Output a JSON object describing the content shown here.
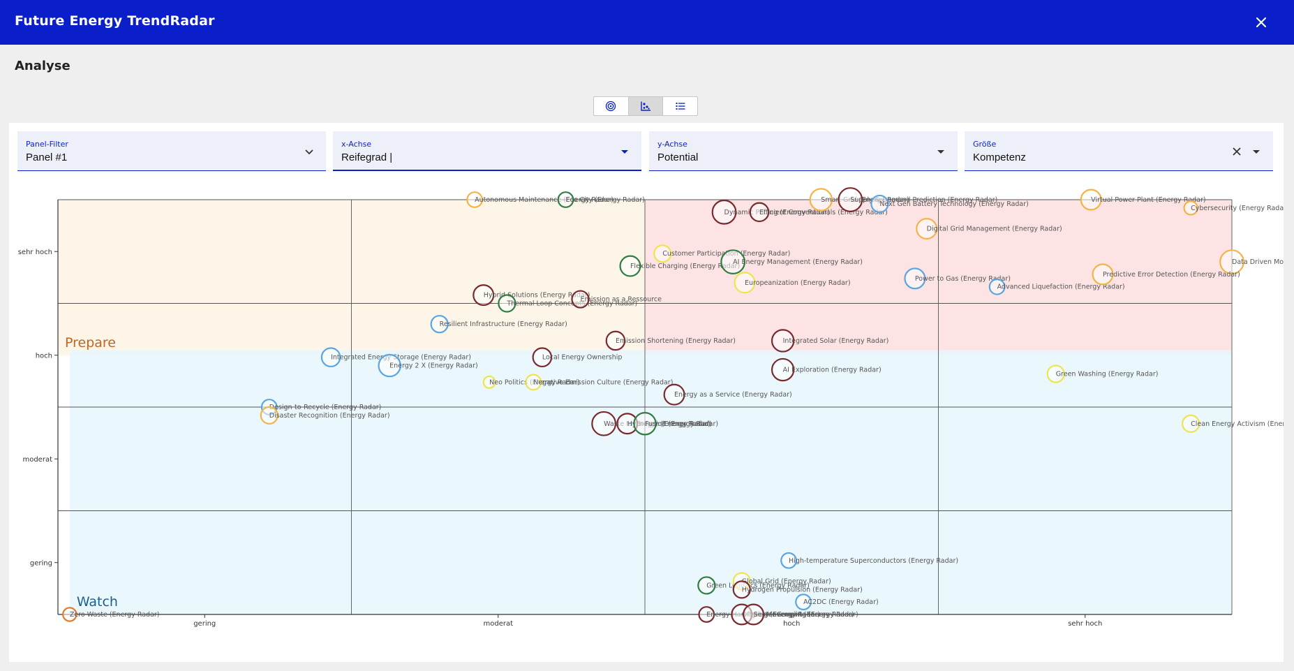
{
  "app": {
    "title": "Future Energy TrendRadar"
  },
  "page": {
    "heading": "Analyse"
  },
  "view_toggle": [
    {
      "name": "radar-view-button",
      "icon": "radar-icon",
      "active": false
    },
    {
      "name": "scatter-view-button",
      "icon": "scatter-chart-icon",
      "active": true
    },
    {
      "name": "list-view-button",
      "icon": "list-icon",
      "active": false
    }
  ],
  "filters": {
    "panel": {
      "label": "Panel-Filter",
      "value": "Panel #1"
    },
    "x_axis": {
      "label": "x-Achse",
      "value": "Reifegrad |"
    },
    "y_axis": {
      "label": "y-Achse",
      "value": "Potential"
    },
    "size": {
      "label": "Größe",
      "value": "Kompetenz"
    }
  },
  "colors": {
    "brand": "#0a1fc9",
    "prepare_zone": "#fdf5e8",
    "act_zone": "#fde3e4",
    "watch_zone": "#e6f6fc",
    "prepare_text": "#c0661f",
    "watch_text": "#1b5f92"
  },
  "chart_data": {
    "type": "scatter",
    "x_ticks": [
      "gering",
      "moderat",
      "hoch",
      "sehr hoch"
    ],
    "y_ticks": [
      "gering",
      "moderat",
      "hoch",
      "sehr hoch"
    ],
    "xlim": [
      0,
      4
    ],
    "ylim": [
      0,
      4
    ],
    "zones": [
      {
        "label": "Prepare",
        "color": "#fdf5e8",
        "text_color": "#c0661f",
        "x": [
          0,
          2
        ],
        "y": [
          2.5,
          4
        ]
      },
      {
        "label": "",
        "color": "#fde3e4",
        "text_color": "#c0661f",
        "x": [
          2,
          4
        ],
        "y": [
          2.5,
          4
        ]
      },
      {
        "label": "Watch",
        "color": "#e6f6fc",
        "text_color": "#1b5f92",
        "x": [
          0.04,
          4
        ],
        "y": [
          0,
          2.55
        ]
      }
    ],
    "points": [
      {
        "label": "Autonomous Maintenance (Energy Radar)",
        "x": 1.42,
        "y": 4.0,
        "size": 0.9,
        "color": "#f3b347"
      },
      {
        "label": "Eco City (Energy Radar)",
        "x": 1.73,
        "y": 4.0,
        "size": 0.9,
        "color": "#2f7d43"
      },
      {
        "label": "Dynamic Pricing (Energy Radar)",
        "x": 2.27,
        "y": 3.88,
        "size": 1.4,
        "color": "#7a2a2f"
      },
      {
        "label": "Efficient Conventionals (Energy Radar)",
        "x": 2.39,
        "y": 3.88,
        "size": 1.1,
        "color": "#7a2a2f"
      },
      {
        "label": "Smart Grid (Energy Radar)",
        "x": 2.6,
        "y": 4.0,
        "size": 1.3,
        "color": "#f3b347"
      },
      {
        "label": "Supply & Demand Prediction (Energy Radar)",
        "x": 2.7,
        "y": 4.0,
        "size": 1.4,
        "color": "#7a2a2f"
      },
      {
        "label": "Next Gen Battery Technology (Energy Radar)",
        "x": 2.8,
        "y": 3.96,
        "size": 1.0,
        "color": "#5aa5e2"
      },
      {
        "label": "Virtual Power Plant (Energy Radar)",
        "x": 3.52,
        "y": 4.0,
        "size": 1.2,
        "color": "#f3b347"
      },
      {
        "label": "Cybersecurity (Energy Radar)",
        "x": 3.86,
        "y": 3.92,
        "size": 0.8,
        "color": "#f3b347"
      },
      {
        "label": "Digital Grid Management (Energy Radar)",
        "x": 2.96,
        "y": 3.72,
        "size": 1.2,
        "color": "#f3b347"
      },
      {
        "label": "Data Driven Modelling (Energy Radar)",
        "x": 4.0,
        "y": 3.4,
        "size": 1.4,
        "color": "#f3b347"
      },
      {
        "label": "Customer Participation (Energy Radar)",
        "x": 2.06,
        "y": 3.48,
        "size": 1.0,
        "color": "#ece54f"
      },
      {
        "label": "Flexible Charging (Energy Radar)",
        "x": 1.95,
        "y": 3.36,
        "size": 1.2,
        "color": "#2f7d43"
      },
      {
        "label": "AI Energy Management (Energy Radar)",
        "x": 2.3,
        "y": 3.4,
        "size": 1.4,
        "color": "#2f7d43"
      },
      {
        "label": "Europeanization (Energy Radar)",
        "x": 2.34,
        "y": 3.2,
        "size": 1.2,
        "color": "#ece54f"
      },
      {
        "label": "Power to Gas (Energy Radar)",
        "x": 2.92,
        "y": 3.24,
        "size": 1.2,
        "color": "#5aa5e2"
      },
      {
        "label": "Advanced Liquefaction (Energy Radar)",
        "x": 3.2,
        "y": 3.16,
        "size": 0.9,
        "color": "#5aa5e2"
      },
      {
        "label": "Predictive Error Detection (Energy Radar)",
        "x": 3.56,
        "y": 3.28,
        "size": 1.2,
        "color": "#f3b347"
      },
      {
        "label": "Hybrid Solutions (Energy Radar)",
        "x": 1.45,
        "y": 3.08,
        "size": 1.2,
        "color": "#7a2a2f"
      },
      {
        "label": "Thermal Loop Concepts (Energy Radar)",
        "x": 1.53,
        "y": 3.0,
        "size": 1.0,
        "color": "#2f7d43"
      },
      {
        "label": "Emission as a Ressource",
        "x": 1.78,
        "y": 3.04,
        "size": 1.0,
        "color": "#7a2a2f"
      },
      {
        "label": "Resilient Infrastructure (Energy Radar)",
        "x": 1.3,
        "y": 2.8,
        "size": 1.0,
        "color": "#5aa5e2"
      },
      {
        "label": "Emission Shortening (Energy Radar)",
        "x": 1.9,
        "y": 2.64,
        "size": 1.1,
        "color": "#7a2a2f"
      },
      {
        "label": "Integrated Solar (Energy Radar)",
        "x": 2.47,
        "y": 2.64,
        "size": 1.3,
        "color": "#7a2a2f"
      },
      {
        "label": "Integrated Energy Storage (Energy Radar)",
        "x": 0.93,
        "y": 2.48,
        "size": 1.1,
        "color": "#5aa5e2"
      },
      {
        "label": "Energy 2 X (Energy Radar)",
        "x": 1.13,
        "y": 2.4,
        "size": 1.3,
        "color": "#5aa5e2"
      },
      {
        "label": "Local Energy Ownership",
        "x": 1.65,
        "y": 2.48,
        "size": 1.1,
        "color": "#7a2a2f"
      },
      {
        "label": "Green Washing (Energy Radar)",
        "x": 3.4,
        "y": 2.32,
        "size": 1.0,
        "color": "#ece54f"
      },
      {
        "label": "Neo Politics (Energy Radar)",
        "x": 1.47,
        "y": 2.24,
        "size": 0.7,
        "color": "#ece54f"
      },
      {
        "label": "Negative Emission Culture (Energy Radar)",
        "x": 1.62,
        "y": 2.24,
        "size": 0.9,
        "color": "#ece54f"
      },
      {
        "label": "AI Exploration (Energy Radar)",
        "x": 2.47,
        "y": 2.36,
        "size": 1.3,
        "color": "#7a2a2f"
      },
      {
        "label": "Energy as a Service (Energy Radar)",
        "x": 2.1,
        "y": 2.12,
        "size": 1.2,
        "color": "#7a2a2f"
      },
      {
        "label": "Design-to-Recycle (Energy Radar)",
        "x": 0.72,
        "y": 2.0,
        "size": 0.9,
        "color": "#5aa5e2"
      },
      {
        "label": "Disaster Recognition (Energy Radar)",
        "x": 0.72,
        "y": 1.92,
        "size": 1.0,
        "color": "#f3b347"
      },
      {
        "label": "Waste to Energy (Energy Radar)",
        "x": 1.86,
        "y": 1.84,
        "size": 1.4,
        "color": "#7a2a2f"
      },
      {
        "label": "Hydrogen (Energy Radar)",
        "x": 1.94,
        "y": 1.84,
        "size": 1.2,
        "color": "#7a2a2f"
      },
      {
        "label": "Fusion (Energy Radar)",
        "x": 2.0,
        "y": 1.84,
        "size": 1.3,
        "color": "#2f7d43"
      },
      {
        "label": "Clean Energy Activism (Energy Radar)",
        "x": 3.86,
        "y": 1.84,
        "size": 1.0,
        "color": "#ece54f"
      },
      {
        "label": "High-temperature Superconductors (Energy Radar)",
        "x": 2.49,
        "y": 0.52,
        "size": 0.9,
        "color": "#5aa5e2"
      },
      {
        "label": "Green Logistics (Energy Radar)",
        "x": 2.21,
        "y": 0.28,
        "size": 1.0,
        "color": "#2f7d43"
      },
      {
        "label": "Global Grid (Energy Radar)",
        "x": 2.33,
        "y": 0.32,
        "size": 1.0,
        "color": "#ece54f"
      },
      {
        "label": "Hydrogen Propulsion (Energy Radar)",
        "x": 2.33,
        "y": 0.24,
        "size": 1.0,
        "color": "#7a2a2f"
      },
      {
        "label": "AC2DC (Energy Radar)",
        "x": 2.54,
        "y": 0.12,
        "size": 0.9,
        "color": "#5aa5e2"
      },
      {
        "label": "Zero Waste (Energy Radar)",
        "x": 0.04,
        "y": 0.0,
        "size": 0.8,
        "color": "#e07a2f"
      },
      {
        "label": "Energy Harvesting (Energy Radar)",
        "x": 2.21,
        "y": 0.0,
        "size": 0.9,
        "color": "#7a2a2f"
      },
      {
        "label": "Offgrid Movement (Energy Radar)",
        "x": 2.33,
        "y": 0.0,
        "size": 1.2,
        "color": "#7a2a2f"
      },
      {
        "label": "Sector Coupling (Energy Radar)",
        "x": 2.37,
        "y": 0.0,
        "size": 1.2,
        "color": "#7a2a2f"
      }
    ]
  }
}
